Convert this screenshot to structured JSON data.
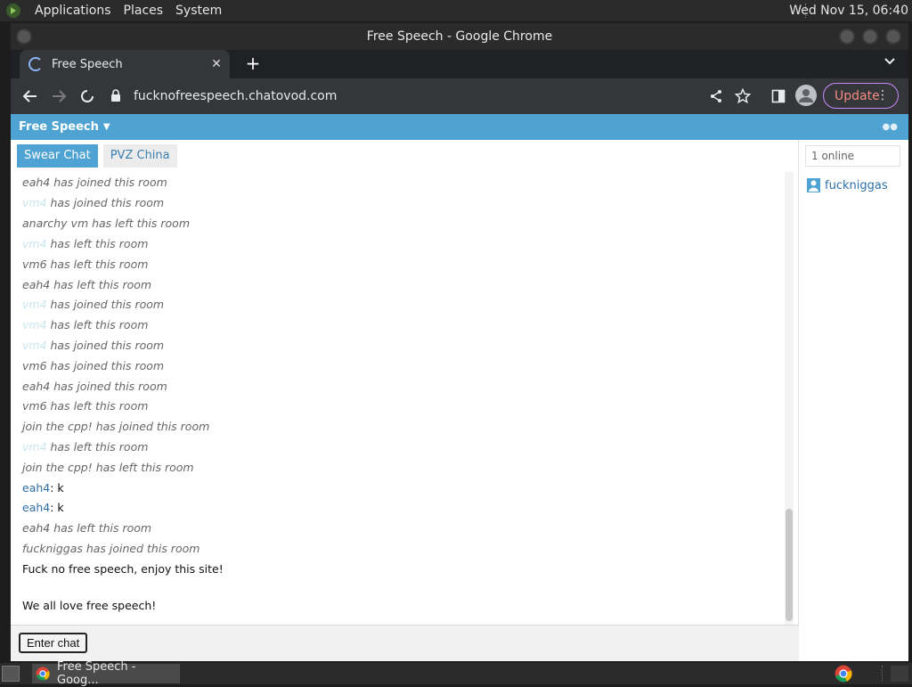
{
  "top_panel": {
    "menus": [
      "Applications",
      "Places",
      "System"
    ],
    "clock": "Wed Nov 15, 06:40"
  },
  "window": {
    "title": "Free Speech - Google Chrome"
  },
  "browser": {
    "tab_title": "Free Speech",
    "url": "fucknofreespeech.chatovod.com",
    "update_label": "Update"
  },
  "site": {
    "header_title": "Free Speech",
    "room_tabs": [
      "Swear Chat",
      "PVZ China"
    ],
    "enter_chat_label": "Enter chat"
  },
  "messages": [
    {
      "kind": "sys",
      "text": "eah4 has joined this room"
    },
    {
      "kind": "faint_sys",
      "name": "vm4",
      "text": " has joined this room"
    },
    {
      "kind": "sys",
      "text": "anarchy vm has left this room"
    },
    {
      "kind": "faint_sys",
      "name": "vm4",
      "text": " has left this room"
    },
    {
      "kind": "sys",
      "text": "vm6 has left this room"
    },
    {
      "kind": "sys",
      "text": "eah4 has left this room"
    },
    {
      "kind": "faint_sys",
      "name": "vm4",
      "text": " has joined this room"
    },
    {
      "kind": "faint_sys",
      "name": "vm4",
      "text": " has left this room"
    },
    {
      "kind": "faint_sys",
      "name": "vm4",
      "text": " has joined this room"
    },
    {
      "kind": "sys",
      "text": "vm6 has joined this room"
    },
    {
      "kind": "sys",
      "text": "eah4 has joined this room"
    },
    {
      "kind": "sys",
      "text": "vm6 has left this room"
    },
    {
      "kind": "sys",
      "text": "join the cpp! has joined this room"
    },
    {
      "kind": "faint_sys",
      "name": "vm4",
      "text": " has left this room"
    },
    {
      "kind": "sys",
      "text": "join the cpp! has left this room"
    },
    {
      "kind": "user",
      "name": "eah4",
      "text": ": k"
    },
    {
      "kind": "user",
      "name": "eah4",
      "text": ": k"
    },
    {
      "kind": "sys",
      "text": "eah4 has left this room"
    },
    {
      "kind": "sys",
      "text": "fuckniggas has joined this room"
    },
    {
      "kind": "plain",
      "text": "Fuck no free speech, enjoy this site!"
    },
    {
      "kind": "plain",
      "text": "We all love free speech!"
    }
  ],
  "sidebar": {
    "online_count": "1 online",
    "users": [
      "fuckniggas"
    ]
  },
  "taskbar": {
    "task_label": "Free Speech - Goog..."
  }
}
